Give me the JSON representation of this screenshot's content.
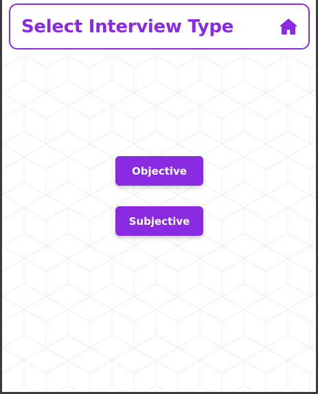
{
  "header": {
    "title": "Select Interview Type",
    "home_icon": "home-icon"
  },
  "buttons": {
    "objective": "Objective",
    "subjective": "Subjective"
  },
  "colors": {
    "accent": "#8a2be2",
    "background": "#ffffff",
    "pattern": "#ececec"
  }
}
